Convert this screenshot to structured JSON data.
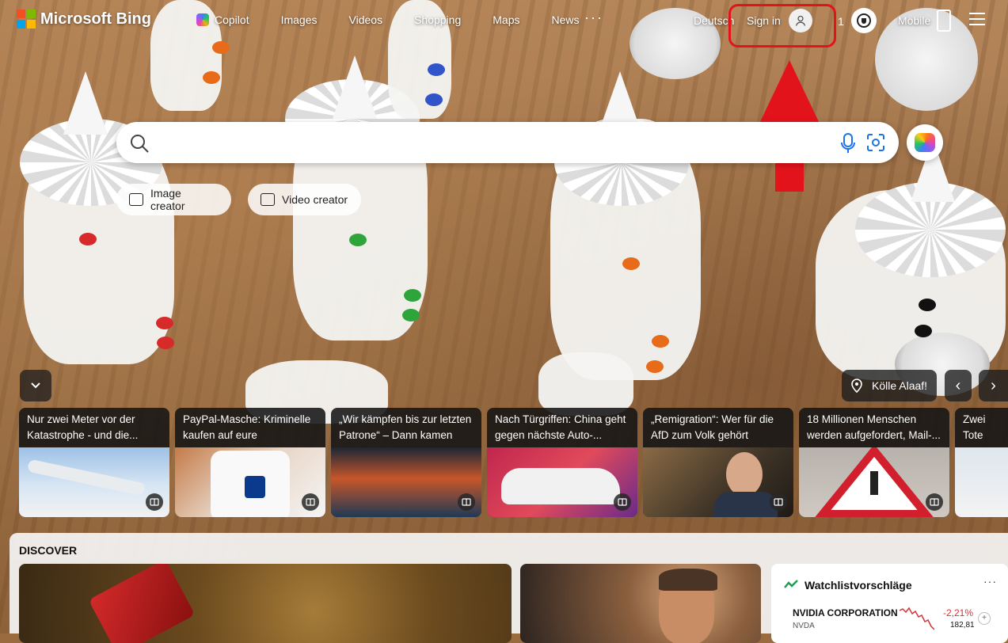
{
  "brand": {
    "name": "Microsoft Bing"
  },
  "nav": {
    "items": [
      "Copilot",
      "Images",
      "Videos",
      "Shopping",
      "Maps",
      "News"
    ],
    "more": "···"
  },
  "header": {
    "language": "Deutsch",
    "sign_in": "Sign in",
    "points": "1",
    "mobile": "Mobile"
  },
  "search": {
    "value": "",
    "placeholder": ""
  },
  "pills": [
    "Image creator",
    "Video creator"
  ],
  "carousel": {
    "location": "Kölle Alaaf!",
    "cards": [
      {
        "title": "Nur zwei Meter vor der Katastrophe - und die..."
      },
      {
        "title": "PayPal-Masche: Kriminelle kaufen auf eure Rechnung,..."
      },
      {
        "title": "„Wir kämpfen bis zur letzten Patrone“ – Dann kamen die..."
      },
      {
        "title": "Nach Türgriffen: China geht gegen nächste Auto-..."
      },
      {
        "title": "„Remigration“: Wer für die AfD zum Volk gehört"
      },
      {
        "title": "18 Millionen Menschen werden aufgefordert, Mail-..."
      },
      {
        "title": "Zwei Tote Lawinenab..."
      }
    ]
  },
  "discover": {
    "title": "DISCOVER",
    "watchlist": {
      "title": "Watchlistvorschläge",
      "more": "···",
      "stock": {
        "name": "NVIDIA CORPORATION",
        "ticker": "NVDA",
        "change": "-2,21%",
        "price": "182,81"
      }
    }
  },
  "colors": {
    "accent_red": "#e3131b",
    "stock_down": "#d1343a"
  }
}
